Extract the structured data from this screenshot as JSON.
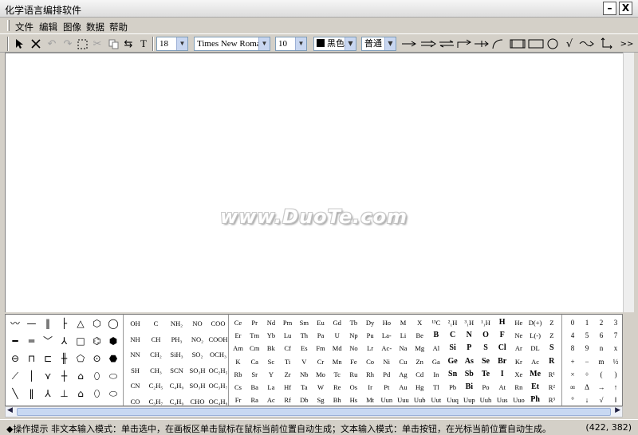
{
  "window": {
    "title": "化学语言编排软件",
    "minimize": "–",
    "close": "X"
  },
  "menu": [
    "文件",
    "编辑",
    "图像",
    "数据",
    "帮助"
  ],
  "toolbar": {
    "tools": [
      "pointer-icon",
      "delete-icon",
      "undo-icon",
      "redo-icon",
      "select-rect-icon",
      "crop-icon",
      "copy-icon",
      "swap-icon"
    ],
    "text_tool": "T",
    "font_size_1": "18",
    "font_name": "Times New Roman",
    "font_size_2": "10",
    "color_name": "黑色",
    "color_value": "#000000",
    "style": "普通",
    "more": ">>"
  },
  "watermark": "www.DuoTe.com",
  "palette": {
    "structures": [
      "〰",
      "—",
      "‖",
      "├",
      "△",
      "⬡",
      "◯",
      "━",
      "═",
      "﹀",
      "⅄",
      "□",
      "⌬",
      "⬢",
      "⊖",
      "⊓",
      "⊏",
      "╫",
      "⬠",
      "⊙",
      "⬣",
      "⟋",
      "│",
      "⋎",
      "┼",
      "⌂",
      "⬯",
      "⬭",
      "╲",
      "‖",
      "⅄",
      "⊥",
      "⌂",
      "⬯",
      "⬭"
    ],
    "formulas": [
      [
        "OH",
        "C",
        "NH₂",
        "NO",
        "COO"
      ],
      [
        "NH",
        "CH",
        "PH₃",
        "NO₂",
        "COOH"
      ],
      [
        "NN",
        "CH₂",
        "SiH₃",
        "SO₂",
        "OCH₃"
      ],
      [
        "SH",
        "CH₃",
        "SCN",
        "SO₃H",
        "OC₂H₅"
      ],
      [
        "CN",
        "C₂H₅",
        "C₄H₉",
        "SO₃H",
        "OC₃H₇"
      ],
      [
        "CO",
        "C₃H₇",
        "C₄H₉",
        "CHO",
        "OC₄H₉"
      ]
    ],
    "elements": [
      [
        "Ce",
        "Pr",
        "Nd",
        "Pm",
        "Sm",
        "Eu",
        "Gd",
        "Tb",
        "Dy",
        "Ho",
        "M",
        "X",
        "¹³C",
        "²₁H",
        "³₁H",
        "¹₁H",
        "H",
        "He",
        "D(+)",
        "Z"
      ],
      [
        "Er",
        "Tm",
        "Yb",
        "Lu",
        "Th",
        "Pa",
        "U",
        "Np",
        "Pu",
        "La-",
        "Li",
        "Be",
        "B",
        "C",
        "N",
        "O",
        "F",
        "Ne",
        "L(-)",
        "Z"
      ],
      [
        "Am",
        "Cm",
        "Bk",
        "Cf",
        "Es",
        "Fm",
        "Md",
        "No",
        "Lr",
        "Ac-",
        "Na",
        "Mg",
        "Al",
        "Si",
        "P",
        "S",
        "Cl",
        "Ar",
        "DL",
        "S"
      ],
      [
        "K",
        "Ca",
        "Sc",
        "Ti",
        "V",
        "Cr",
        "Mn",
        "Fe",
        "Co",
        "Ni",
        "Cu",
        "Zn",
        "Ga",
        "Ge",
        "As",
        "Se",
        "Br",
        "Kr",
        "Ac",
        "R"
      ],
      [
        "Rb",
        "Sr",
        "Y",
        "Zr",
        "Nb",
        "Mo",
        "Tc",
        "Ru",
        "Rh",
        "Pd",
        "Ag",
        "Cd",
        "In",
        "Sn",
        "Sb",
        "Te",
        "I",
        "Xe",
        "Me",
        "R¹"
      ],
      [
        "Cs",
        "Ba",
        "La",
        "Hf",
        "Ta",
        "W",
        "Re",
        "Os",
        "Ir",
        "Pt",
        "Au",
        "Hg",
        "Tl",
        "Pb",
        "Bi",
        "Po",
        "At",
        "Rn",
        "Et",
        "R²"
      ],
      [
        "Fr",
        "Ra",
        "Ac",
        "Rf",
        "Db",
        "Sg",
        "Bh",
        "Hs",
        "Mt",
        "Uun",
        "Uuu",
        "Uub",
        "Uut",
        "Uuq",
        "Uup",
        "Uuh",
        "Uus",
        "Uuo",
        "Ph",
        "R³"
      ]
    ],
    "digits": [
      [
        "0",
        "1",
        "2",
        "3"
      ],
      [
        "4",
        "5",
        "6",
        "7"
      ],
      [
        "8",
        "9",
        "n",
        "x"
      ],
      [
        "+",
        "−",
        "m",
        "½"
      ],
      [
        "×",
        "÷",
        "(",
        ")"
      ],
      [
        "∞",
        "Δ",
        "→",
        "↑"
      ],
      [
        "°",
        "↓",
        "√",
        "‖"
      ]
    ]
  },
  "status": {
    "hint": "◆操作提示  非文本输入模式：单击选中，在画板区单击鼠标在鼠标当前位置自动生成；文本输入模式：单击按钮，在光标当前位置自动生成。",
    "coords": "(422, 382)"
  }
}
